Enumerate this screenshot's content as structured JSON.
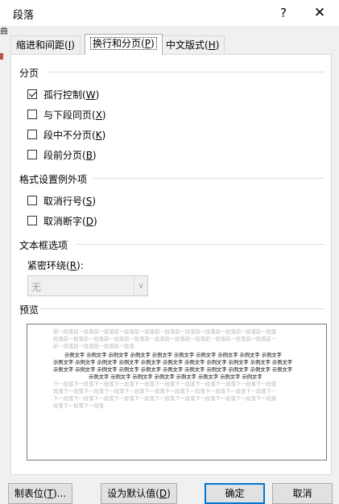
{
  "window": {
    "title": "段落",
    "help": "?",
    "close": "✕"
  },
  "edge_glyph": "曲",
  "tabs": [
    {
      "label": "缩进和间距(",
      "key": "I",
      "tail": ")"
    },
    {
      "label": "换行和分页(",
      "key": "P",
      "tail": ")"
    },
    {
      "label": "中文版式(",
      "key": "H",
      "tail": ")"
    }
  ],
  "pagination": {
    "title": "分页",
    "options": [
      {
        "label": "孤行控制(",
        "key": "W",
        "tail": ")",
        "checked": true
      },
      {
        "label": "与下段同页(",
        "key": "X",
        "tail": ")",
        "checked": false
      },
      {
        "label": "段中不分页(",
        "key": "K",
        "tail": ")",
        "checked": false
      },
      {
        "label": "段前分页(",
        "key": "B",
        "tail": ")",
        "checked": false
      }
    ]
  },
  "exceptions": {
    "title": "格式设置例外项",
    "options": [
      {
        "label": "取消行号(",
        "key": "S",
        "tail": ")",
        "checked": false
      },
      {
        "label": "取消断字(",
        "key": "D",
        "tail": ")",
        "checked": false
      }
    ]
  },
  "textbox": {
    "title": "文本框选项",
    "wrap_label": "紧密环绕(",
    "wrap_key": "R",
    "wrap_tail": "):",
    "wrap_value": "无"
  },
  "preview": {
    "title": "预览",
    "prev_lines": [
      "前一段落前一段落前一段落前一段落前一段落前一段落前一段落前一段落前一段落前一段落前一段落",
      "段落前一段落前一段落前一段落前一段落前一段落前一段落前一段落前一段落前一段落前一段落前一",
      "前一段落前一段落前一段落前一段落"
    ],
    "cur_lines": [
      "示例文字 示例文字 示例文字 示例文字 示例文字 示例文字 示例文字 示例文字 示例文字 示例文字",
      "示例文字 示例文字 示例文字 示例文字 示例文字 示例文字 示例文字 示例文字 示例文字 示例文字 示例文字",
      "示例文字 示例文字 示例文字 示例文字 示例文字 示例文字 示例文字 示例文字 示例文字 示例文字 示例文字",
      "示例文字 示例文字 示例文字 示例文字 示例文字 示例文字 示例文字 示例文字"
    ],
    "next_lines": [
      "下一段落下一段落下一段落下一段落下一段落下一段落下一段落下一段落下一段落下一段落下一段落",
      "段落下一段落下一段落下一段落下一段落下一段落下一段落下一段落下一段落下一段落下一段落下一",
      "下一段落下一段落下一段落下一段落下一段落下一段落下一段落下一段落下一段落下一段落下一段落",
      "段落下一段落下一段落"
    ]
  },
  "buttons": {
    "tabs_label": "制表位(",
    "tabs_key": "T",
    "tabs_tail": ")...",
    "default_label": "设为默认值(",
    "default_key": "D",
    "default_tail": ")",
    "ok": "确定",
    "cancel": "取消"
  }
}
